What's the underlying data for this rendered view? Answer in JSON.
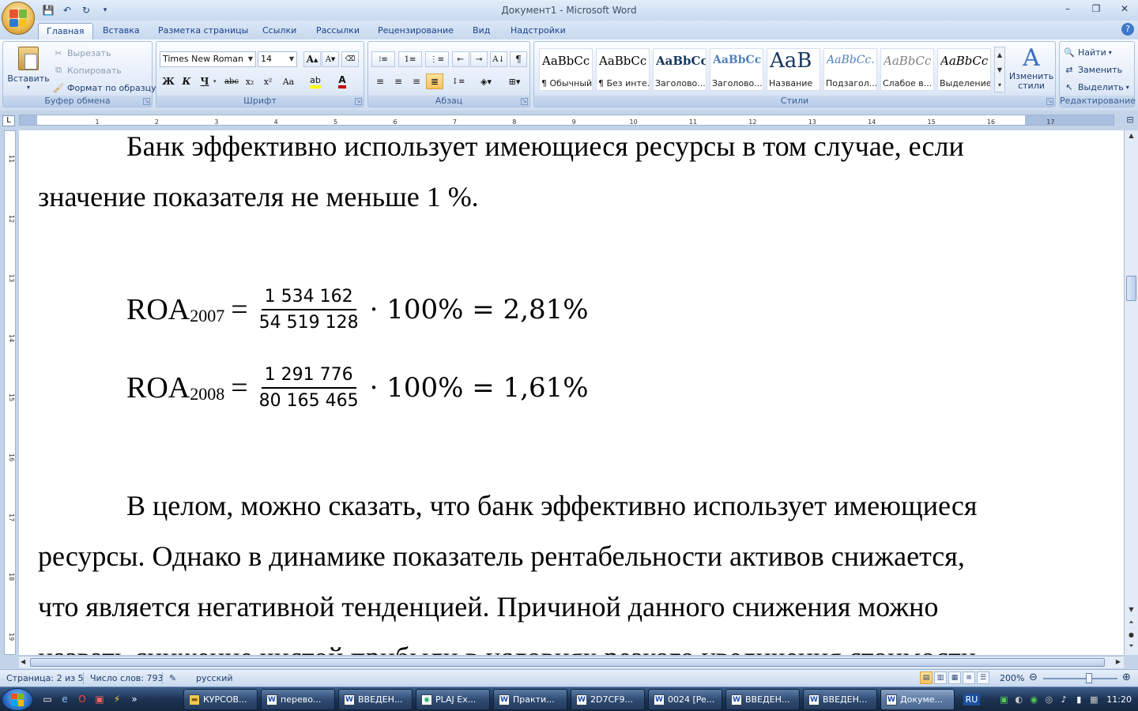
{
  "window": {
    "title": "Документ1 - Microsoft Word"
  },
  "tabs": [
    "Главная",
    "Вставка",
    "Разметка страницы",
    "Ссылки",
    "Рассылки",
    "Рецензирование",
    "Вид",
    "Надстройки"
  ],
  "clipboard": {
    "paste": "Вставить",
    "cut": "Вырезать",
    "copy": "Копировать",
    "format_painter": "Формат по образцу",
    "label": "Буфер обмена"
  },
  "font": {
    "name": "Times New Roman",
    "size": "14",
    "label": "Шрифт",
    "bold": "Ж",
    "italic": "К",
    "underline": "Ч",
    "strike": "abc",
    "sub": "x₂",
    "sup": "x²",
    "case": "Aa",
    "grow": "A",
    "shrink": "A"
  },
  "paragraph": {
    "label": "Абзац"
  },
  "styles": {
    "label": "Стили",
    "change": "Изменить стили",
    "items": [
      {
        "sample": "AaBbCc",
        "name": "¶ Обычный",
        "color": "#000000"
      },
      {
        "sample": "AaBbCc",
        "name": "¶ Без инте...",
        "color": "#000000"
      },
      {
        "sample": "AaBbCc",
        "name": "Заголово...",
        "color": "#17365d"
      },
      {
        "sample": "AaBbCc",
        "name": "Заголово...",
        "color": "#4f81bd"
      },
      {
        "sample": "AaB",
        "name": "Название",
        "color": "#17365d"
      },
      {
        "sample": "AaBbCc.",
        "name": "Подзагол...",
        "color": "#4f81bd"
      },
      {
        "sample": "AaBbCc",
        "name": "Слабое в...",
        "color": "#808080"
      },
      {
        "sample": "AaBbCc",
        "name": "Выделение",
        "color": "#000000"
      }
    ]
  },
  "editing": {
    "label": "Редактирование",
    "find": "Найти",
    "replace": "Заменить",
    "select": "Выделить"
  },
  "ruler_h": [
    "1",
    "2",
    "3",
    "4",
    "5",
    "6",
    "7",
    "8",
    "9",
    "10",
    "11",
    "12",
    "13",
    "14",
    "15",
    "16",
    "17"
  ],
  "ruler_v": [
    "11",
    "12",
    "13",
    "14",
    "15",
    "16",
    "17",
    "18",
    "19"
  ],
  "document": {
    "para1_first": "Банк эффективно использует имеющиеся ресурсы в том случае, если",
    "para1_second": "значение показателя не меньше 1 %.",
    "formula1": {
      "lhs": "ROA",
      "sub": "2007",
      "eq": "=",
      "num": "1 534 162",
      "den": "54 519 128",
      "rest": "· 100% = 2,81%"
    },
    "formula2": {
      "lhs": "ROA",
      "sub": "2008",
      "eq": "=",
      "num": "1 291 776",
      "den": "80 165 465",
      "rest": "· 100% = 1,61%"
    },
    "para2_l1": "В целом, можно сказать, что банк эффективно использует имеющиеся",
    "para2_l2": "ресурсы. Однако в динамике показатель рентабельности активов снижается,",
    "para2_l3": "что является негативной тенденцией. Причиной данного снижения можно",
    "para2_l4": "назвать снижение чистой прибыли в условиях резкого увеличения стоимости"
  },
  "status": {
    "page": "Страница: 2 из 5",
    "words": "Число слов: 793",
    "lang": "русский",
    "zoom": "200%"
  },
  "taskbar": {
    "tasks": [
      "КУРСОВ...",
      "перево...",
      "ВВЕДЕН...",
      "PLAJ Ex...",
      "Практи...",
      "2D7CF9...",
      "0024 [Pe...",
      "ВВЕДЕН...",
      "ВВЕДЕН...",
      "Докуме..."
    ],
    "lang": "RU",
    "time": "11:20"
  }
}
